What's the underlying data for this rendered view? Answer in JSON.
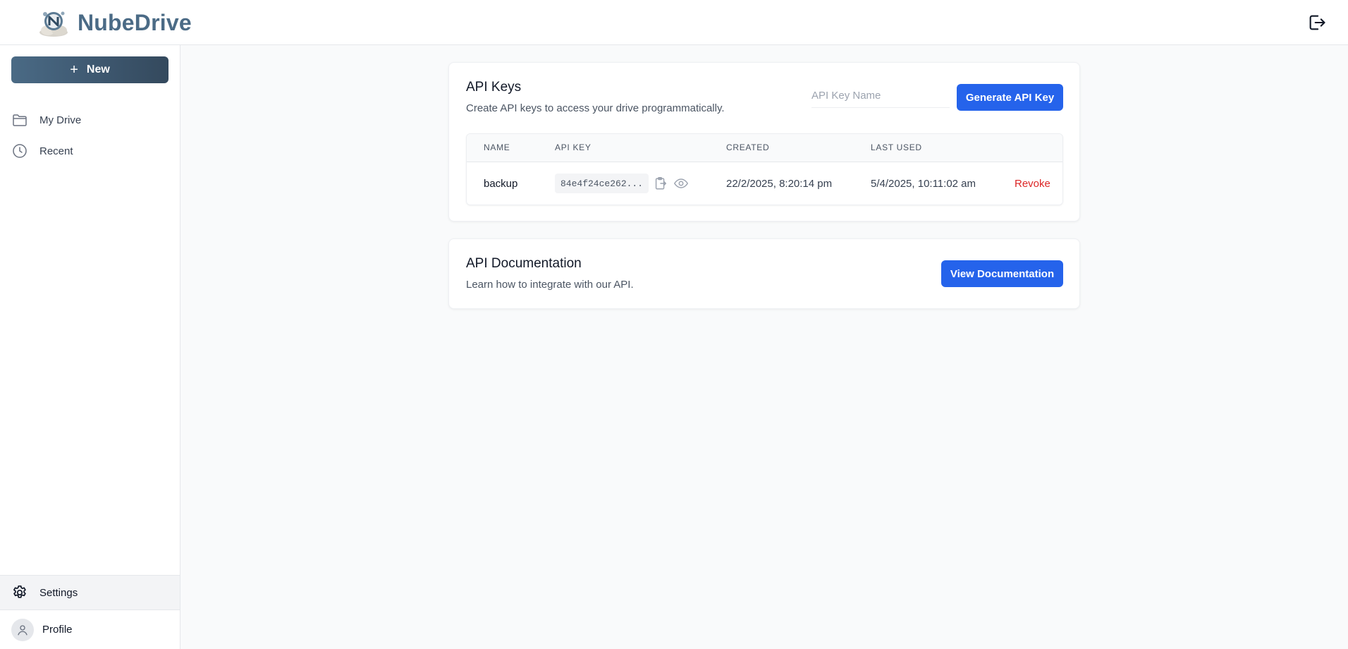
{
  "app": {
    "name": "NubeDrive"
  },
  "sidebar": {
    "new_label": "New",
    "items": [
      {
        "label": "My Drive",
        "icon": "folder-icon"
      },
      {
        "label": "Recent",
        "icon": "clock-icon"
      }
    ],
    "settings_label": "Settings",
    "profile_label": "Profile"
  },
  "api_keys": {
    "title": "API Keys",
    "subtitle": "Create API keys to access your drive programmatically.",
    "input_placeholder": "API Key Name",
    "input_value": "",
    "generate_label": "Generate API Key",
    "table": {
      "headers": [
        "Name",
        "API Key",
        "Created",
        "Last Used"
      ],
      "rows": [
        {
          "name": "backup",
          "key": "84e4f24ce262...",
          "created": "22/2/2025, 8:20:14 pm",
          "last_used": "5/4/2025, 10:11:02 am",
          "action": "Revoke"
        }
      ]
    }
  },
  "api_docs": {
    "title": "API Documentation",
    "subtitle": "Learn how to integrate with our API.",
    "button_label": "View Documentation"
  },
  "colors": {
    "primary": "#2563eb",
    "brand": "#4b6b86",
    "danger": "#dc2626"
  }
}
